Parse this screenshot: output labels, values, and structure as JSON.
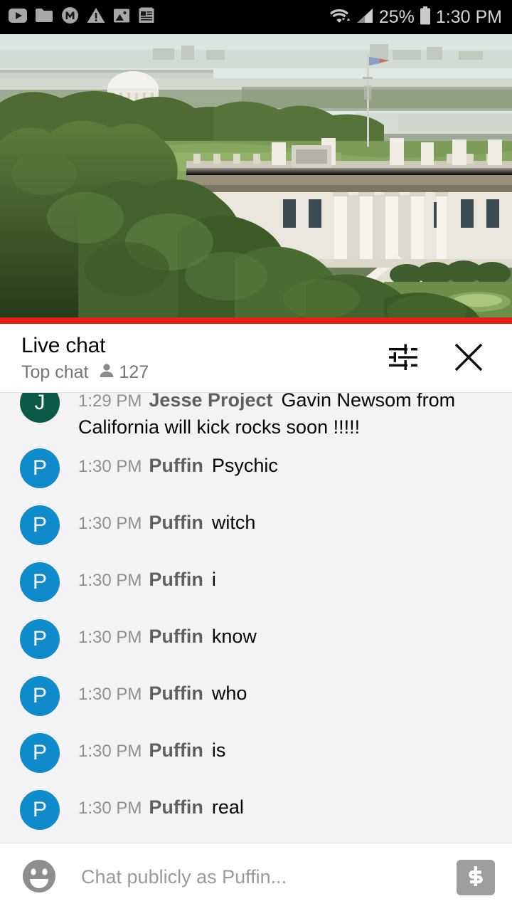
{
  "status_bar": {
    "icons": [
      "youtube-play-icon",
      "folder-icon",
      "m-circle-icon",
      "warning-triangle-icon",
      "image-icon",
      "notes-icon"
    ],
    "wifi_icon": "wifi-icon",
    "signal_icon": "cell-signal-icon",
    "battery_label": "25%",
    "battery_icon": "battery-icon",
    "clock": "1:30 PM"
  },
  "video": {
    "name": "white-house-live-stream",
    "progress_color": "#e52117"
  },
  "chat_header": {
    "title": "Live chat",
    "subtitle": "Top chat",
    "viewer_icon": "person-icon",
    "viewer_count": "127",
    "filter_icon": "tune-filter-icon",
    "close_icon": "close-icon"
  },
  "messages": [
    {
      "avatar_letter": "J",
      "avatar_color": "#0b5a47",
      "time": "1:29 PM",
      "author": "Jesse Project",
      "text": "Gavin Newsom from California will kick rocks soon !!!!!",
      "clipped": true
    },
    {
      "avatar_letter": "P",
      "avatar_color": "#0f8bcc",
      "time": "1:30 PM",
      "author": "Puffin",
      "text": "Psychic"
    },
    {
      "avatar_letter": "P",
      "avatar_color": "#0f8bcc",
      "time": "1:30 PM",
      "author": "Puffin",
      "text": "witch"
    },
    {
      "avatar_letter": "P",
      "avatar_color": "#0f8bcc",
      "time": "1:30 PM",
      "author": "Puffin",
      "text": "i"
    },
    {
      "avatar_letter": "P",
      "avatar_color": "#0f8bcc",
      "time": "1:30 PM",
      "author": "Puffin",
      "text": "know"
    },
    {
      "avatar_letter": "P",
      "avatar_color": "#0f8bcc",
      "time": "1:30 PM",
      "author": "Puffin",
      "text": "who"
    },
    {
      "avatar_letter": "P",
      "avatar_color": "#0f8bcc",
      "time": "1:30 PM",
      "author": "Puffin",
      "text": "is"
    },
    {
      "avatar_letter": "P",
      "avatar_color": "#0f8bcc",
      "time": "1:30 PM",
      "author": "Puffin",
      "text": "real"
    }
  ],
  "composer": {
    "emoji_icon": "emoji-smiley-icon",
    "placeholder": "Chat publicly as Puffin...",
    "value": "",
    "superchat_icon": "super-chat-dollar-icon"
  }
}
